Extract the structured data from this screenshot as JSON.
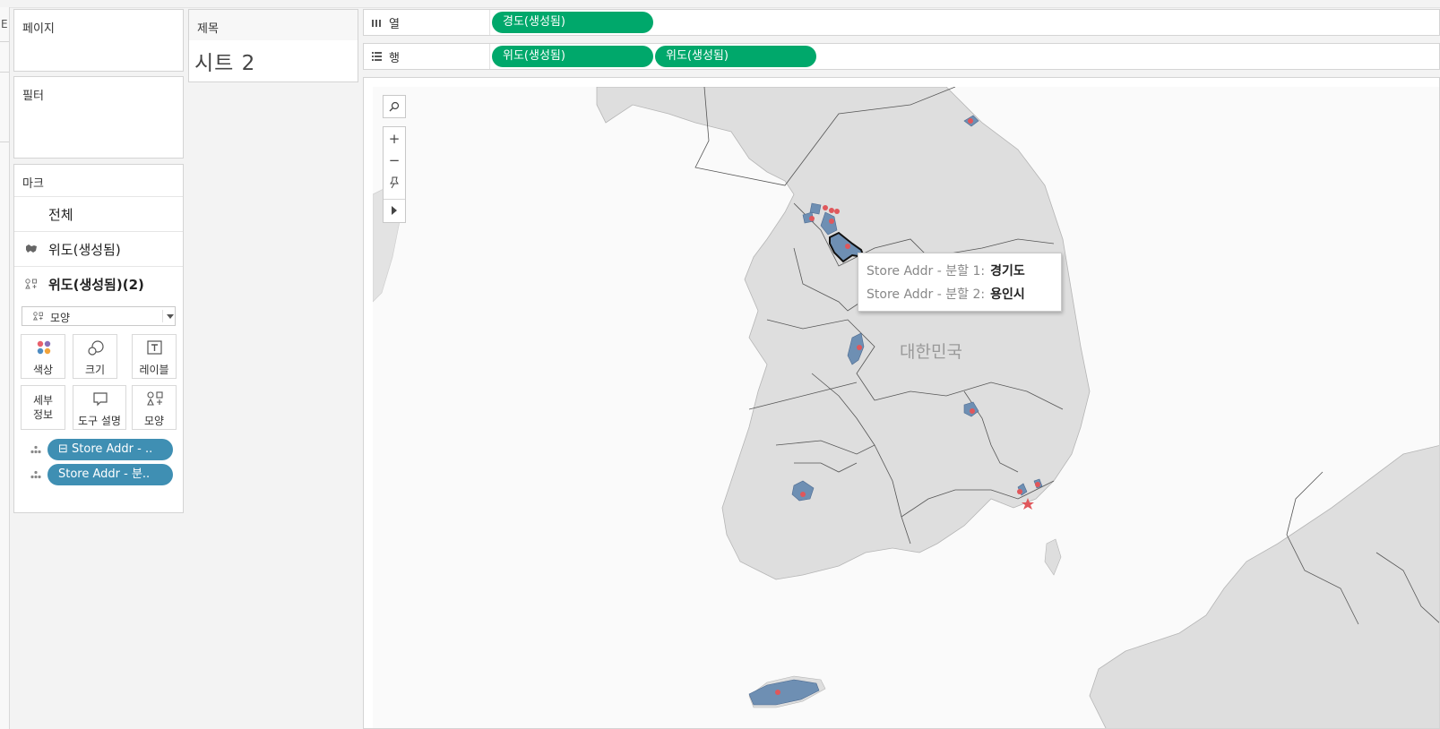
{
  "cards": {
    "pages_title": "페이지",
    "filters_title": "필터",
    "marks_title": "마크",
    "title_card_label": "제목",
    "sheet_title": "시트 2"
  },
  "marks": {
    "all_label": "전체",
    "layer1_label": "위도(생성됨)",
    "layer2_label": "위도(생성됨)(2)",
    "mark_type": "모양",
    "buttons": {
      "color": "색상",
      "size": "크기",
      "label": "레이블",
      "detail": "세부\n정보",
      "tooltip": "도구 설명",
      "shape": "모양"
    },
    "fields": [
      "⊟ Store Addr - ..",
      "Store Addr - 분.."
    ]
  },
  "shelves": {
    "columns_label": "열",
    "rows_label": "행",
    "columns_pills": [
      "경도(생성됨)"
    ],
    "rows_pills": [
      "위도(생성됨)",
      "위도(생성됨)"
    ]
  },
  "map": {
    "country_label": "대한민국",
    "controls": [
      "search-icon",
      "zoom-in",
      "zoom-out",
      "pin-icon",
      "expand-toolbar"
    ]
  },
  "tooltip": {
    "row1_label": "Store Addr - 분할 1:",
    "row1_value": "경기도",
    "row2_label": "Store Addr - 분할 2:",
    "row2_value": "용인시"
  },
  "colors": {
    "pill_green": "#00a86b",
    "pill_blue": "#3f8fb3",
    "region_fill": "#6e8fb3",
    "marker_red": "#e0575b",
    "land": "#dedede"
  }
}
